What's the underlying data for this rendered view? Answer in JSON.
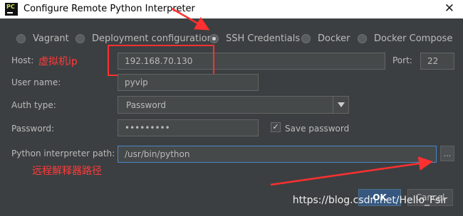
{
  "window": {
    "title": "Configure Remote Python Interpreter"
  },
  "tabs": [
    {
      "label": "Vagrant",
      "selected": false
    },
    {
      "label": "Deployment configuration",
      "selected": false
    },
    {
      "label": "SSH Credentials",
      "selected": true
    },
    {
      "label": "Docker",
      "selected": false
    },
    {
      "label": "Docker Compose",
      "selected": false
    }
  ],
  "form": {
    "host_label": "Host:",
    "host_value": "192.168.70.130",
    "port_label": "Port:",
    "port_value": "22",
    "username_label": "User name:",
    "username_value": "pyvip",
    "auth_type_label": "Auth type:",
    "auth_type_value": "Password",
    "password_label": "Password:",
    "password_value": "•••••••••",
    "save_password_label": "Save password",
    "save_password_checked": true,
    "interpreter_label": "Python interpreter path:",
    "interpreter_value": "/usr/bin/python",
    "browse_label": "..."
  },
  "annotations": {
    "host_note": "虚拟机ip",
    "path_note": "远程解释器路径"
  },
  "buttons": {
    "ok": "OK",
    "cancel": "Cancel"
  },
  "watermark": "https://blog.csdn.net/Hello_Fsir",
  "colors": {
    "background": "#3c3f41",
    "annotation": "#ff3030",
    "selection": "#4a88c7"
  }
}
